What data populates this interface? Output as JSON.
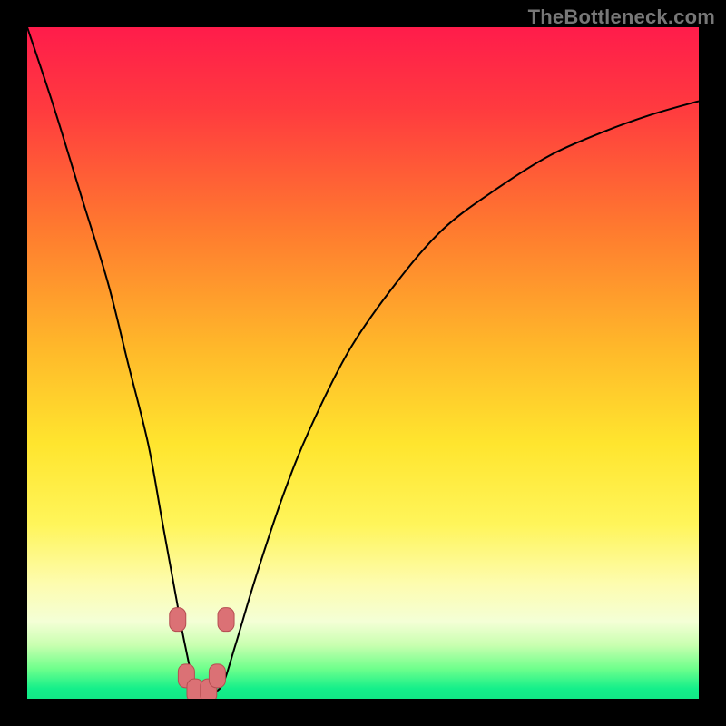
{
  "watermark": "TheBottleneck.com",
  "colors": {
    "frame": "#000000",
    "curve": "#000000",
    "marker_fill": "#db7175",
    "marker_stroke": "#b54d51",
    "gradient_stops": [
      {
        "offset": 0.0,
        "color": "#ff1c4b"
      },
      {
        "offset": 0.12,
        "color": "#ff3a3f"
      },
      {
        "offset": 0.3,
        "color": "#ff7a2f"
      },
      {
        "offset": 0.48,
        "color": "#ffb92a"
      },
      {
        "offset": 0.62,
        "color": "#ffe52e"
      },
      {
        "offset": 0.74,
        "color": "#fff55a"
      },
      {
        "offset": 0.83,
        "color": "#fdfcb0"
      },
      {
        "offset": 0.885,
        "color": "#f4ffd6"
      },
      {
        "offset": 0.92,
        "color": "#c9ffb0"
      },
      {
        "offset": 0.955,
        "color": "#6fff8c"
      },
      {
        "offset": 0.985,
        "color": "#14ef8a"
      },
      {
        "offset": 1.0,
        "color": "#12e886"
      }
    ]
  },
  "chart_data": {
    "type": "line",
    "title": "",
    "xlabel": "",
    "ylabel": "",
    "xlim": [
      0,
      100
    ],
    "ylim": [
      0,
      100
    ],
    "series": [
      {
        "name": "bottleneck-curve",
        "x": [
          0,
          4,
          8,
          12,
          15,
          18,
          20,
          22,
          23.5,
          25,
          27,
          29,
          31,
          34,
          38,
          42,
          48,
          55,
          62,
          70,
          78,
          86,
          93,
          100
        ],
        "values": [
          100,
          88,
          75,
          62,
          50,
          38,
          27,
          16,
          8,
          2,
          1,
          2,
          8,
          18,
          30,
          40,
          52,
          62,
          70,
          76,
          81,
          84.5,
          87,
          89
        ]
      }
    ],
    "markers": {
      "name": "highlight-points",
      "x": [
        22.4,
        23.7,
        25.0,
        27.0,
        28.3,
        29.6
      ],
      "values": [
        11.8,
        3.4,
        1.2,
        1.2,
        3.4,
        11.8
      ]
    },
    "legend": false,
    "grid": false
  }
}
